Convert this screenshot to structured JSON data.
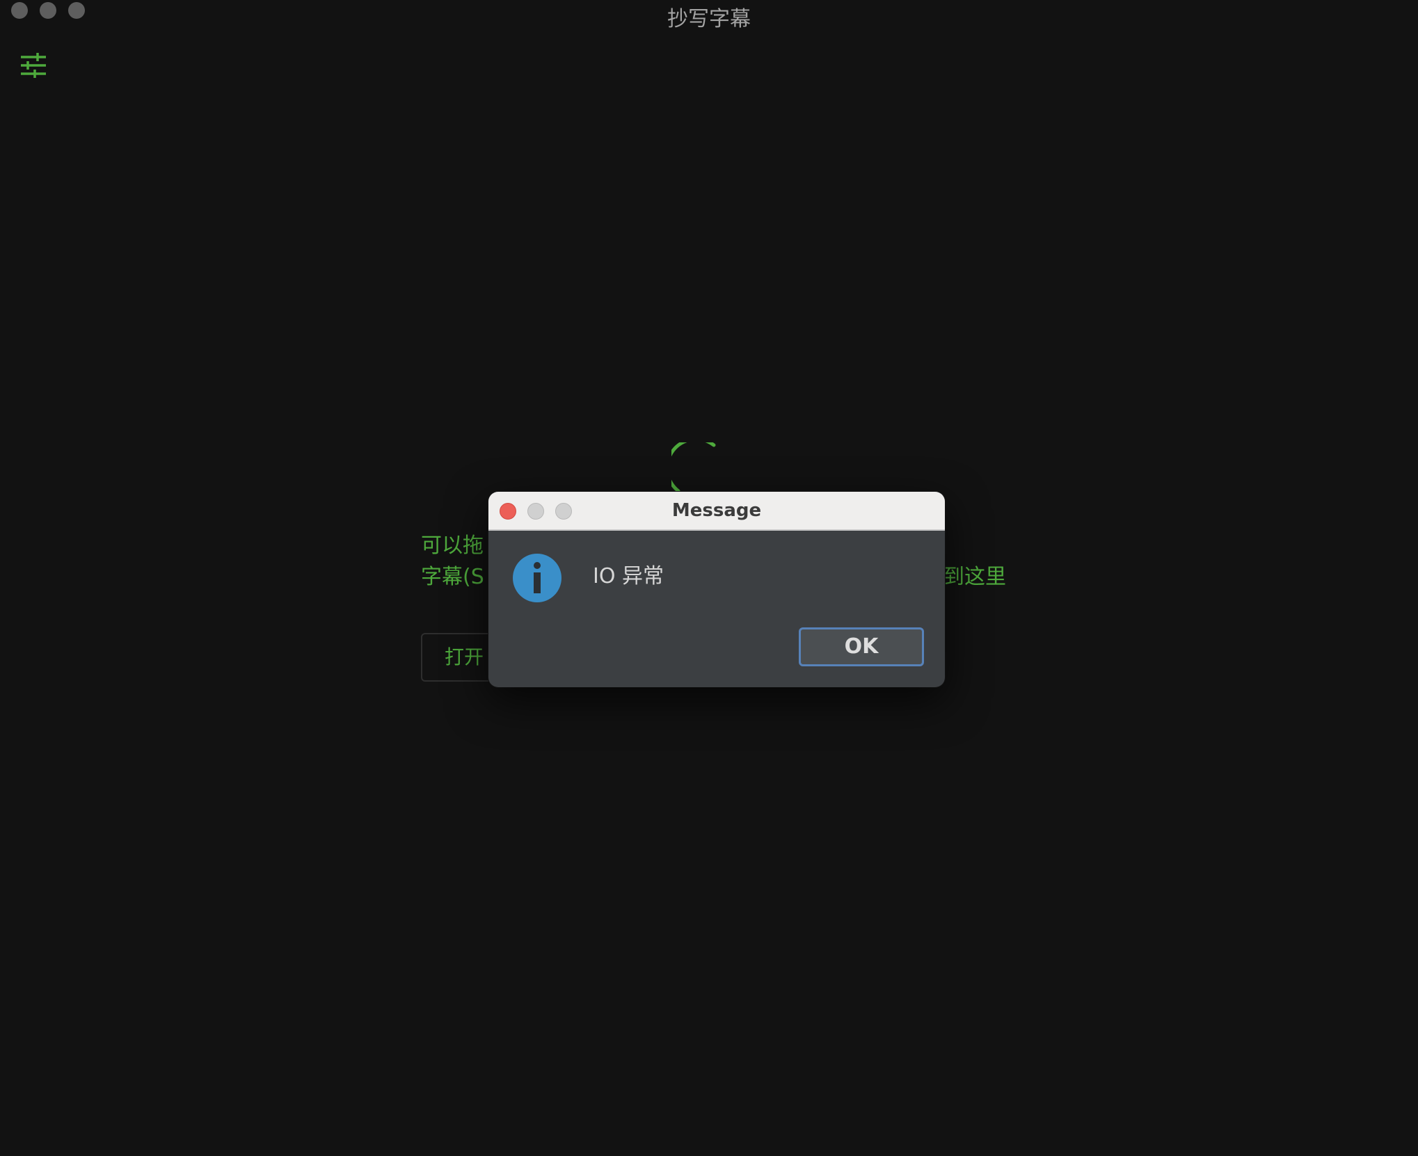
{
  "window": {
    "title": "抄写字幕",
    "controls": [
      "close",
      "minimize",
      "maximize"
    ]
  },
  "toolbar": {
    "settings_icon": "sliders-icon"
  },
  "main": {
    "hint_line1_left": "可以拖",
    "hint_line2_left": "字幕(S",
    "hint_line2_right": "到这里",
    "open_button_label": "打开",
    "loading": true
  },
  "dialog": {
    "title": "Message",
    "icon": "info-icon",
    "message": "IO 异常",
    "ok_label": "OK"
  },
  "colors": {
    "accent_green": "#4eaa3c",
    "background": "#121212",
    "dialog_body": "#3c3f42",
    "info_blue": "#3a8fc9",
    "ok_focus_ring": "#5782b9"
  }
}
